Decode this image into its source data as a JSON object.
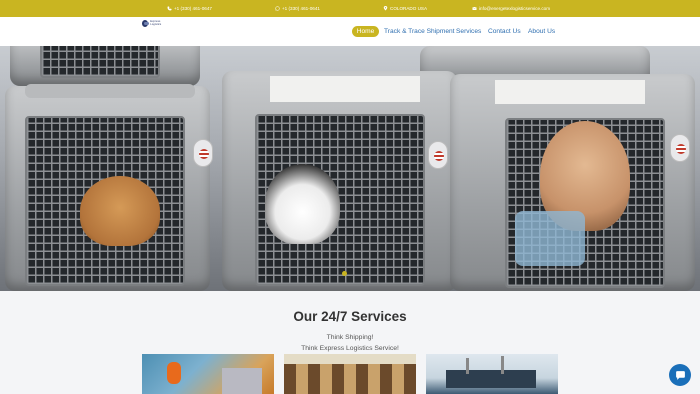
{
  "topbar": {
    "phone1": "+1 (330) 461-0647",
    "phone2": "+1 (330) 461-0641",
    "location": "COLORADO USA",
    "email": "info@energetexlogisticservice.com",
    "bg_color": "#c9b521",
    "icons": [
      "phone-icon",
      "whatsapp-icon",
      "map-pin-icon",
      "mail-icon"
    ]
  },
  "nav": {
    "logo_text": "Express Logistics",
    "items": [
      "Home",
      "Track & Trace Shipment",
      "Services",
      "Contact Us",
      "About Us"
    ],
    "active": "Home",
    "link_color": "#2f6fb0",
    "active_color": "#c9b521"
  },
  "hero": {
    "image_subject": "dogs-in-pet-crates",
    "slide_indicator_color": "#c9b521"
  },
  "services": {
    "title": "Our 24/7 Services",
    "line1": "Think Shipping!",
    "line2": "Think Express Logistics Service!",
    "thumbnails": [
      "worker-with-pallet-jack",
      "warehouse-shelves",
      "cargo-ship-port"
    ]
  },
  "chat": {
    "icon": "chat-bubble-icon",
    "color": "#1a6fb9"
  }
}
